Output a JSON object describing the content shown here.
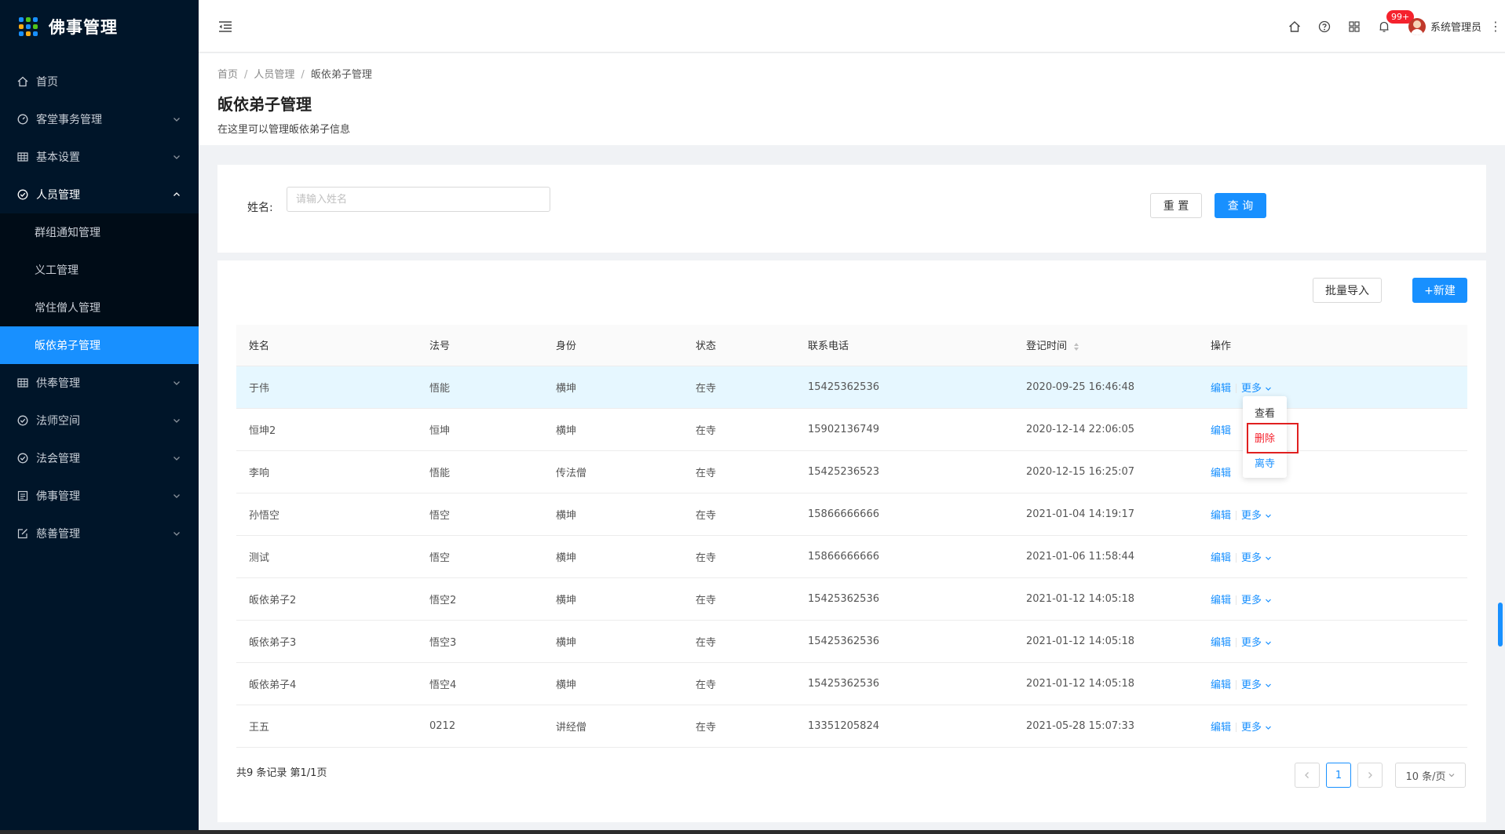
{
  "app": {
    "title": "佛事管理"
  },
  "sidebar": {
    "items": [
      {
        "label": "首页",
        "icon": "home-icon"
      },
      {
        "label": "客堂事务管理",
        "icon": "dashboard-icon"
      },
      {
        "label": "基本设置",
        "icon": "table-icon"
      },
      {
        "label": "人员管理",
        "icon": "check-circle-icon",
        "open": true
      },
      {
        "label": "供奉管理",
        "icon": "table-icon"
      },
      {
        "label": "法师空间",
        "icon": "check-circle-icon"
      },
      {
        "label": "法会管理",
        "icon": "check-circle-icon"
      },
      {
        "label": "佛事管理",
        "icon": "profile-icon"
      },
      {
        "label": "慈善管理",
        "icon": "form-icon"
      }
    ],
    "sub_items": [
      {
        "label": "群组通知管理"
      },
      {
        "label": "义工管理"
      },
      {
        "label": "常住僧人管理"
      },
      {
        "label": "皈依弟子管理",
        "active": true
      }
    ]
  },
  "header": {
    "notification_count": "99+",
    "user_name": "系统管理员"
  },
  "breadcrumb": [
    "首页",
    "人员管理",
    "皈依弟子管理"
  ],
  "page": {
    "title": "皈依弟子管理",
    "description": "在这里可以管理皈依弟子信息"
  },
  "search": {
    "label": "姓名:",
    "placeholder": "请输入姓名",
    "value": "",
    "reset_label": "重 置",
    "query_label": "查 询"
  },
  "table_actions": {
    "import_label": "批量导入",
    "new_label": "+新建"
  },
  "table": {
    "columns": [
      "姓名",
      "法号",
      "身份",
      "状态",
      "联系电话",
      "登记时间",
      "操作"
    ],
    "edit_label": "编辑",
    "more_label": "更多",
    "rows": [
      {
        "name": "于伟",
        "dharma": "悟能",
        "identity": "横坤",
        "status": "在寺",
        "phone": "15425362536",
        "time": "2020-09-25 16:46:48"
      },
      {
        "name": "恒坤2",
        "dharma": "恒坤",
        "identity": "横坤",
        "status": "在寺",
        "phone": "15902136749",
        "time": "2020-12-14 22:06:05"
      },
      {
        "name": "李响",
        "dharma": "悟能",
        "identity": "传法僧",
        "status": "在寺",
        "phone": "15425236523",
        "time": "2020-12-15 16:25:07"
      },
      {
        "name": "孙悟空",
        "dharma": "悟空",
        "identity": "横坤",
        "status": "在寺",
        "phone": "15866666666",
        "time": "2021-01-04 14:19:17"
      },
      {
        "name": "测试",
        "dharma": "悟空",
        "identity": "横坤",
        "status": "在寺",
        "phone": "15866666666",
        "time": "2021-01-06 11:58:44"
      },
      {
        "name": "皈依弟子2",
        "dharma": "悟空2",
        "identity": "横坤",
        "status": "在寺",
        "phone": "15425362536",
        "time": "2021-01-12 14:05:18"
      },
      {
        "name": "皈依弟子3",
        "dharma": "悟空3",
        "identity": "横坤",
        "status": "在寺",
        "phone": "15425362536",
        "time": "2021-01-12 14:05:18"
      },
      {
        "name": "皈依弟子4",
        "dharma": "悟空4",
        "identity": "横坤",
        "status": "在寺",
        "phone": "15425362536",
        "time": "2021-01-12 14:05:18"
      },
      {
        "name": "王五",
        "dharma": "0212",
        "identity": "讲经僧",
        "status": "在寺",
        "phone": "13351205824",
        "time": "2021-05-28 15:07:33"
      }
    ]
  },
  "dropdown": {
    "view_label": "查看",
    "delete_label": "删除",
    "leave_label": "离寺"
  },
  "pagination": {
    "total_text": "共9 条记录 第1/1页",
    "current_page": "1",
    "page_size": "10 条/页"
  },
  "colors": {
    "primary": "#1890ff",
    "sidebar_bg": "#001529",
    "danger": "#f5222d",
    "highlight_box": "#e02020"
  }
}
